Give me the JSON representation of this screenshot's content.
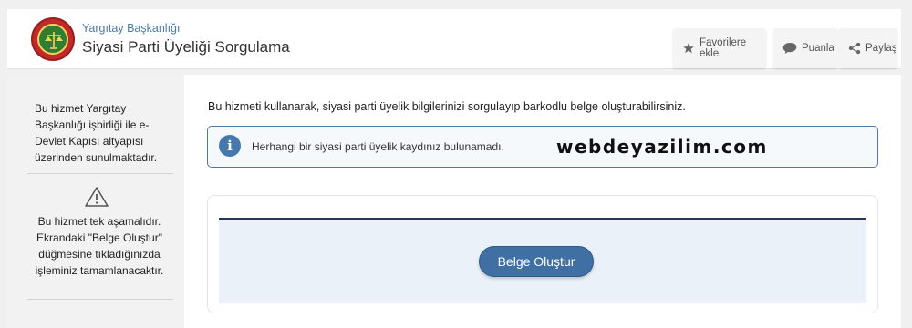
{
  "header": {
    "organization": "Yargıtay Başkanlığı",
    "title": "Siyasi Parti Üyeliği Sorgulama",
    "logo_text": "YARGITAY",
    "actions": {
      "favorites": "Favorilere ekle",
      "rate": "Puanla",
      "share": "Paylaş"
    }
  },
  "sidebar": {
    "info": "Bu hizmet Yargıtay Başkanlığı işbirliği ile e-Devlet Kapısı altyapısı üzerinden sunulmaktadır.",
    "steps_note": "Bu hizmet tek aşamalıdır. Ekrandaki \"Belge Oluştur\" düğmesine tıkladığınızda işleminiz tamamlanacaktır.",
    "icons": {
      "warning": "warning-triangle-icon"
    }
  },
  "main": {
    "intro": "Bu hizmeti kullanarak, siyasi parti üyelik bilgilerinizi sorgulayıp barkodlu belge oluşturabilirsiniz.",
    "alert": {
      "icon": "info-icon",
      "message": "Herhangi bir siyasi parti üyelik kaydınız bulunamadı."
    },
    "watermark": "webdeyazilim.com",
    "create_button": "Belge Oluştur"
  },
  "colors": {
    "accent": "#3f6fa3",
    "alert_border": "#4d78a3",
    "panel_bg": "#eaf1f9",
    "org_text": "#4a7cab"
  }
}
